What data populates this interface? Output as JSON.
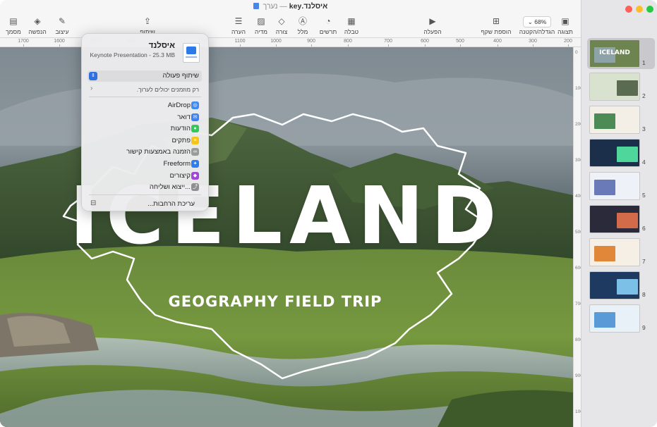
{
  "window": {
    "title": "איסלנד.key",
    "title_suffix": "— נערך",
    "traffic_colors": [
      "#ff5f57",
      "#febc2e",
      "#28c840"
    ]
  },
  "toolbar": {
    "items": [
      {
        "label": "תצוגה",
        "icon": "sidebar-icon",
        "glyph": "▣"
      },
      {
        "label": "הגדלה/הקטנה",
        "icon": "zoom-icon",
        "value": "68%"
      },
      {
        "label": "הוספת שקף",
        "icon": "add-slide-icon",
        "glyph": "⊞"
      },
      {
        "label": "הפעלה",
        "icon": "play-icon",
        "glyph": "▶"
      },
      {
        "label": "טבלה",
        "icon": "table-icon",
        "glyph": "▦"
      },
      {
        "label": "תרשים",
        "icon": "chart-icon",
        "glyph": "◔"
      },
      {
        "label": "מלל",
        "icon": "text-icon",
        "glyph": "Ⓐ"
      },
      {
        "label": "צורה",
        "icon": "shape-icon",
        "glyph": "◇"
      },
      {
        "label": "מדיה",
        "icon": "media-icon",
        "glyph": "▨"
      },
      {
        "label": "הערה",
        "icon": "comment-icon",
        "glyph": "☰"
      },
      {
        "label": "שיתוף",
        "icon": "share-icon",
        "glyph": "⇪"
      },
      {
        "label": "עיצוב",
        "icon": "format-icon",
        "glyph": "✎"
      },
      {
        "label": "הנפשה",
        "icon": "animate-icon",
        "glyph": "◈"
      },
      {
        "label": "מסמך",
        "icon": "document-icon",
        "glyph": "▤"
      }
    ]
  },
  "ruler": {
    "ticks": [
      "1700",
      "1600",
      "1500",
      "1400",
      "1300",
      "1200",
      "1100",
      "1000",
      "900",
      "800",
      "700",
      "600",
      "500",
      "400",
      "300",
      "200",
      "100",
      "0"
    ],
    "vticks": [
      "0",
      "100",
      "200",
      "300",
      "400",
      "500",
      "600",
      "700",
      "800",
      "900",
      "1000"
    ]
  },
  "slide": {
    "title": "ICELAND",
    "subtitle": "GEOGRAPHY FIELD TRIP"
  },
  "navigator": {
    "slides": [
      {
        "number": "1",
        "label": "ICELAND"
      },
      {
        "number": "2"
      },
      {
        "number": "3"
      },
      {
        "number": "4"
      },
      {
        "number": "5"
      },
      {
        "number": "6"
      },
      {
        "number": "7"
      },
      {
        "number": "8"
      },
      {
        "number": "9"
      }
    ]
  },
  "popover": {
    "title": "איסלנד",
    "subtitle": "Keynote Presentation - 25.3 MB",
    "collab_option": "שיתוף פעולה",
    "permission": "רק מוזמנים יכולים לערוך.",
    "items": [
      {
        "label": "AirDrop",
        "icon": "airdrop-icon",
        "color": "#3d8bf2",
        "glyph": "◎"
      },
      {
        "label": "דואר",
        "icon": "mail-icon",
        "color": "#3b82f6",
        "glyph": "✉"
      },
      {
        "label": "הודעות",
        "icon": "messages-icon",
        "color": "#34c759",
        "glyph": "●"
      },
      {
        "label": "פתקים",
        "icon": "notes-icon",
        "color": "#f5c518",
        "glyph": "≡"
      },
      {
        "label": "הזמנה באמצעות קישור",
        "icon": "link-icon",
        "color": "#9a9a9a",
        "glyph": "∞"
      },
      {
        "label": "Freeform",
        "icon": "freeform-icon",
        "color": "#2f7ef0",
        "glyph": "✦"
      },
      {
        "label": "קיצורים",
        "icon": "shortcuts-icon",
        "color": "#a046d8",
        "glyph": "◆"
      },
      {
        "label": "ייצוא ושליחה...",
        "icon": "export-icon",
        "color": "#8e8e93",
        "glyph": "⤴"
      }
    ],
    "edit_extensions": "עריכת הרחבות...",
    "edit_icon": "extensions-icon"
  }
}
